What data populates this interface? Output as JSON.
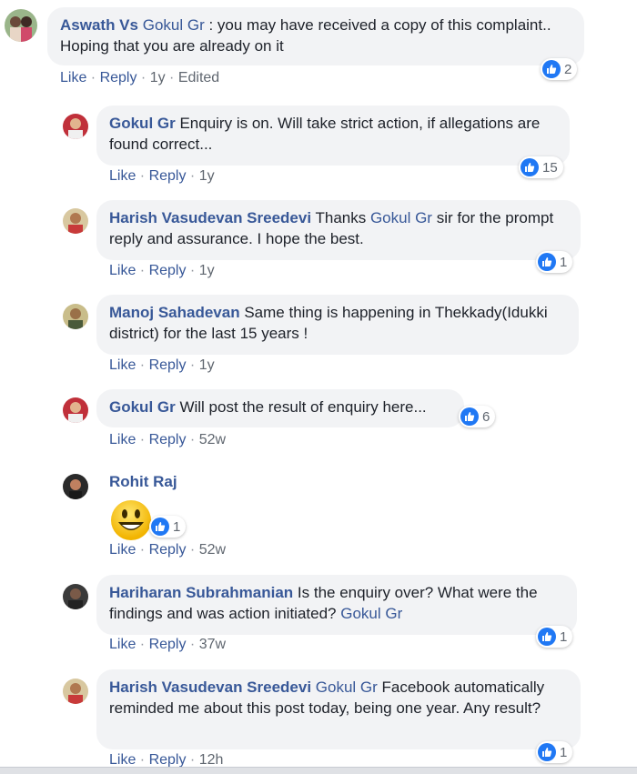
{
  "colors": {
    "link": "#385898",
    "bubble": "#f2f3f5",
    "meta": "#606770",
    "like_blue": "#2078f4"
  },
  "comments": [
    {
      "author": "Aswath Vs",
      "mention": "Gokul Gr",
      "text_after_mention": " : you may have received a copy of this complaint.. Hoping that you are already on it",
      "like_label": "Like",
      "reply_label": "Reply",
      "time": "1y",
      "edited": "Edited",
      "reactions": "2"
    },
    {
      "author": "Gokul Gr",
      "text": " Enquiry is on. Will take strict action, if allegations are found correct...",
      "like_label": "Like",
      "reply_label": "Reply",
      "time": "1y",
      "reactions": "15"
    },
    {
      "author": "Harish Vasudevan Sreedevi",
      "text_before_mention": " Thanks ",
      "mention": "Gokul Gr",
      "text_after_mention": " sir for the prompt reply and assurance. I hope the best.",
      "like_label": "Like",
      "reply_label": "Reply",
      "time": "1y",
      "reactions": "1"
    },
    {
      "author": "Manoj Sahadevan",
      "text": " Same thing is happening in Thekkady(Idukki district) for the last 15 years !",
      "like_label": "Like",
      "reply_label": "Reply",
      "time": "1y"
    },
    {
      "author": "Gokul Gr",
      "text": " Will post the result of enquiry here...",
      "like_label": "Like",
      "reply_label": "Reply",
      "time": "52w",
      "reactions": "6"
    },
    {
      "author": "Rohit Raj",
      "like_label": "Like",
      "reply_label": "Reply",
      "time": "52w",
      "reactions": "1"
    },
    {
      "author": "Hariharan Subrahmanian",
      "text": " Is the enquiry over? What were the findings and was action initiated? ",
      "mention": "Gokul Gr",
      "like_label": "Like",
      "reply_label": "Reply",
      "time": "37w",
      "reactions": "1"
    },
    {
      "author": "Harish Vasudevan Sreedevi",
      "mention": "Gokul Gr",
      "text_after_mention": " Facebook automatically reminded me about this post today, being one year. Any result?",
      "like_label": "Like",
      "reply_label": "Reply",
      "time": "12h",
      "reactions": "1"
    }
  ],
  "separator": " · "
}
